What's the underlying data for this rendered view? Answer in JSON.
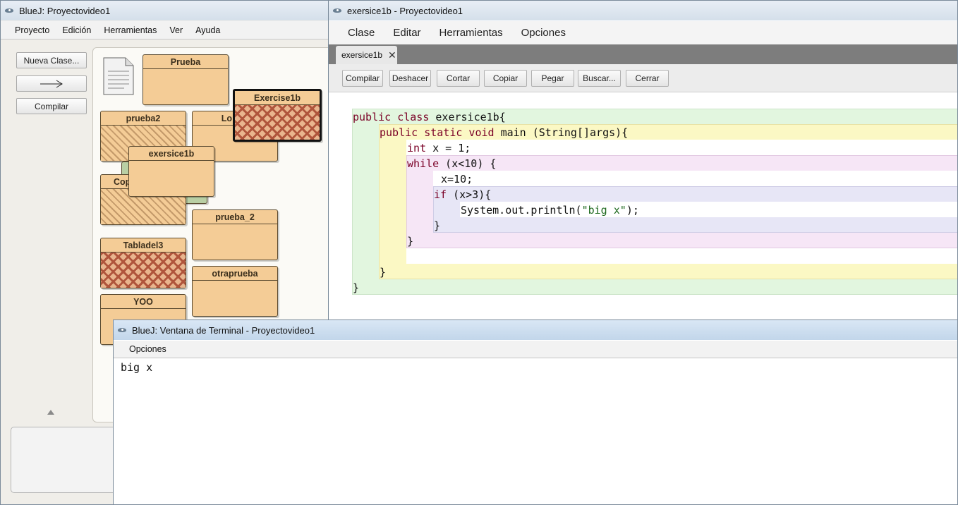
{
  "main_window": {
    "title": "BlueJ: Proyectovideo1",
    "menu": [
      "Proyecto",
      "Edición",
      "Herramientas",
      "Ver",
      "Ayuda"
    ],
    "buttons": {
      "new_class": "Nueva Clase...",
      "compile": "Compilar"
    },
    "classes": {
      "prueba": "Prueba",
      "exercise1b": "Exercise1b",
      "prueba2": "prueba2",
      "lo": "Lo",
      "exersice1b": "exersice1b",
      "cop": "Cop",
      "prueba_2": "prueba_2",
      "tabladel3": "Tabladel3",
      "otraprueba": "otraprueba",
      "yoo": "YOO"
    }
  },
  "editor_window": {
    "title": "exersice1b - Proyectovideo1",
    "menu": [
      "Clase",
      "Editar",
      "Herramientas",
      "Opciones"
    ],
    "tab_label": "exersice1b",
    "toolbar": [
      "Compilar",
      "Deshacer",
      "Cortar",
      "Copiar",
      "Pegar",
      "Buscar...",
      "Cerrar"
    ],
    "code": {
      "l1_kw1": "public",
      "l1_kw2": "class",
      "l1_rest": " exersice1b{",
      "l2_kw": "public static void",
      "l2_rest": " main (String[]args){",
      "l3_kw": "int",
      "l3_rest": " x = 1;",
      "l4_kw": "while",
      "l4_rest": " (x<10) {",
      "l5": "x=10;",
      "l6_kw": "if",
      "l6_rest": " (x>3){",
      "l7_a": "System.out.println(",
      "l7_str": "\"big x\"",
      "l7_b": ");",
      "close": "}"
    }
  },
  "terminal_window": {
    "title": "BlueJ: Ventana de Terminal - Proyectovideo1",
    "menu": "Opciones",
    "output": "big x"
  }
}
